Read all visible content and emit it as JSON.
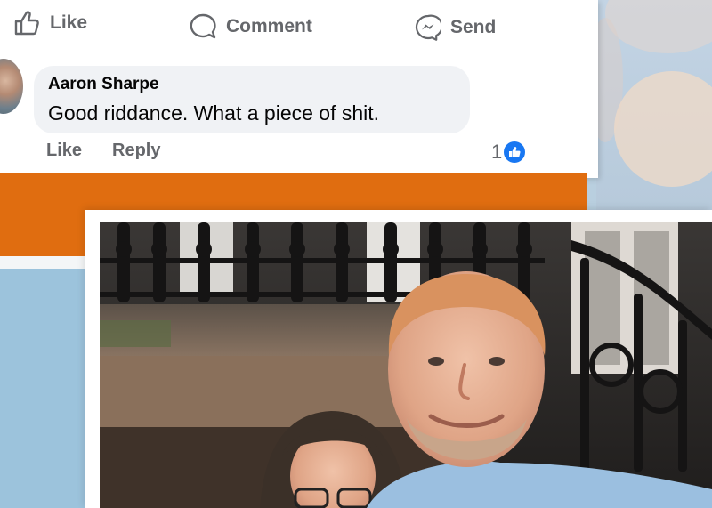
{
  "actions": {
    "like_label": "Like",
    "comment_label": "Comment",
    "send_label": "Send"
  },
  "comment": {
    "author": "Aaron Sharpe",
    "text": "Good riddance. What a piece of shit.",
    "like_label": "Like",
    "reply_label": "Reply",
    "reaction_count": "1"
  },
  "colors": {
    "facebook_blue": "#1877f2",
    "orange_band": "#e06d10",
    "bubble_bg": "#f0f2f5"
  },
  "icons": [
    "thumbs-up-icon",
    "comment-icon",
    "messenger-icon",
    "like-reaction-icon"
  ]
}
